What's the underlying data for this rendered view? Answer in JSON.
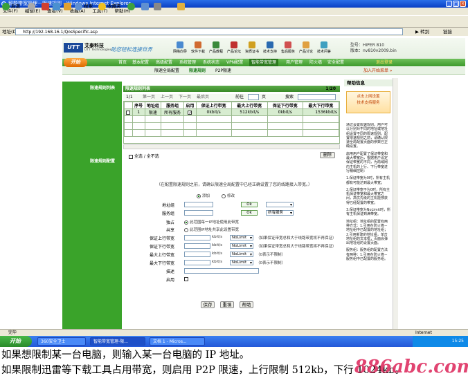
{
  "window": {
    "title": "智能带宽管理－限速规则 - Windows Internet Explorer"
  },
  "menu": [
    "文件(F)",
    "编辑(E)",
    "查看(V)",
    "收藏(A)",
    "工具(T)",
    "帮助(H)"
  ],
  "toolbar": {
    "back": "后退",
    "search": "搜索",
    "favorites": "收藏夹"
  },
  "address": {
    "label": "地址(D)",
    "url": "http://192.168.16.1/QosSpecific.asp",
    "go": "转到",
    "links": "链接"
  },
  "header": {
    "logo": "UTT",
    "brand": "艾泰科技",
    "brand_sub": "UTT Technologies",
    "slogan": "助您轻松连接世界",
    "model_line1": "型号：HiPER 810",
    "model_line2": "版本：nv810v2009.bin",
    "icons": [
      "网络向导",
      "软件下载",
      "产品教程",
      "产品论坛",
      "资质证书",
      "技术支持",
      "售后服务",
      "产品讨论",
      "技术问答"
    ]
  },
  "nav": {
    "start": "开始",
    "items": [
      "首页",
      "基本配置",
      "高级配置",
      "系统管理",
      "系统状态",
      "VPN配置",
      "智能带宽管理",
      "用户管理",
      "防火墙",
      "安全配置"
    ],
    "active": "智能带宽管理",
    "exit": "退出登录"
  },
  "subnav": {
    "items": [
      "限速全局配置",
      "限速规则",
      "P2P限速"
    ],
    "active": "限速规则",
    "addfav": "加入开始菜单 »"
  },
  "left": {
    "label1": "限速规则列表",
    "label2": "限速规则配置"
  },
  "list": {
    "title": "限速规则列表",
    "page_ratio": "1/20",
    "page_info": "1/1",
    "first": "第一页",
    "prev": "上一页",
    "next": "下一页",
    "last": "最后页",
    "goto_prefix": "前往",
    "goto_suffix": "页",
    "search": "搜索",
    "columns": [
      "",
      "序号",
      "地址组",
      "服务组",
      "启用",
      "保证上行带宽",
      "最大上行带宽",
      "保证下行带宽",
      "最大下行带宽"
    ],
    "rows": [
      {
        "no": "1",
        "addr": "限速",
        "svc": "所有服务",
        "enabled": true,
        "gup": "0kbit/s",
        "mup": "512kbit/s",
        "gdown": "0kbit/s",
        "mdown": "1536kbit/s"
      }
    ],
    "select_all": "全选 / 全不选",
    "delete": "删除"
  },
  "form": {
    "note": "（在配置限速规则之前，请确认限速全局配置中已经正确设置了您的线路接入带宽。）",
    "note_link": "限速全局配置",
    "mode_add": "添加",
    "mode_edit": "修改",
    "addr_label": "地址组",
    "svc_label": "服务组",
    "ok": "Ok",
    "svc_select": "所有服务",
    "exclusive_label": "独占",
    "exclusive_text": "此范围每一IP地址使用此带宽",
    "shared_label": "共享",
    "shared_text": "此范围IP地址共享此设置带宽",
    "gup_label": "保证上行带宽",
    "gdown_label": "保证下行带宽",
    "mup_label": "最大上行带宽",
    "mdown_label": "最大下行带宽",
    "desc_label": "描述",
    "enable_label": "启用",
    "unit": "kbit/s",
    "nolimit": "NoLimit",
    "hint_g": "（如果保证带宽总和大于线路带宽将不再保证）",
    "hint_m": "（0表示不限制）",
    "save": "保存",
    "reset": "重填",
    "help": "帮助"
  },
  "help": {
    "title": "帮助信息",
    "banner1": "点击上网设置",
    "banner2": "技术支持服务",
    "p1": "通过设置限速规则，用户可以分别对不同的地址或地址组设置不同的限速规则。配置限速规则之前，请确认限速全局配置页面的参数已正确设置。",
    "p2": "启用用户配置了保证带宽和最大带宽后，根据用户设定保证带宽的不同，为局域网内主机的上行、下行带宽进行精细控制：",
    "p3": "1.保证带宽为0时，所有主机都有可能达到最大带宽；",
    "p4": "2.保证带宽不为0时，所有主机保证带宽和最大带宽之间，高优先级的主机能够获得已经配置的带宽；",
    "p5": "3.保证带宽为NoLimit时，所有主机保证到满带宽。",
    "p6": "地址组：地址组的配置有两种方式：1.引用在防火墙－地址组中已配置的地址组；2.引用新建的地址组，单击地址组的文本框，页面会弹出地址组的设置页面。",
    "p7": "服务组：服务组的配置方法有两种：1.引用在防火墙－服务组中已配置的服务组。"
  },
  "status": "完毕",
  "status_zone": "Internet",
  "taskbar": {
    "start": "开始",
    "tasks": [
      "360安全卫士",
      "智能带宽管理-限...",
      "文档 1 - Micros..."
    ],
    "time": "15:25"
  },
  "caption": {
    "line1": "如果想限制某一台电脑，则输入某一台电脑的 IP 地址。",
    "line2": "如果限制迅雷等下载工具占用带宽，则启用 P2P 限速，上行限制 512kb，下行 1024kb。"
  },
  "watermark": "886abc.com"
}
